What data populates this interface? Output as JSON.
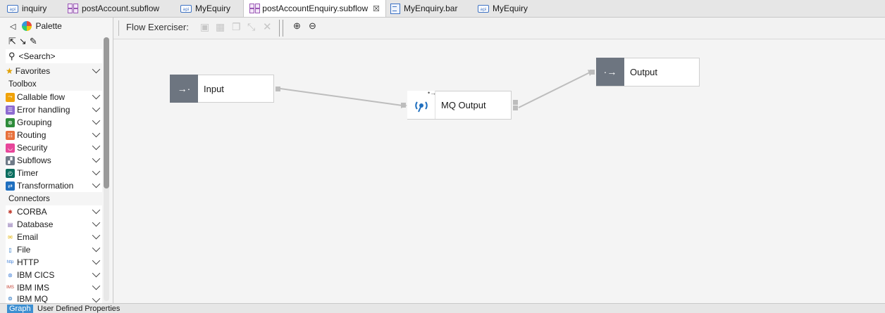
{
  "tabs": [
    {
      "label": "inquiry",
      "icon": "api-icon"
    },
    {
      "label": "postAccount.subflow",
      "icon": "subflow-icon"
    },
    {
      "label": "MyEquiry",
      "icon": "api-icon"
    },
    {
      "label": "postAccountEnquiry.subflow",
      "icon": "subflow-icon",
      "active": true
    },
    {
      "label": "MyEnquiry.bar",
      "icon": "bar-file-icon"
    },
    {
      "label": "MyEquiry",
      "icon": "api-icon"
    }
  ],
  "palette": {
    "title": "Palette",
    "search_placeholder": "<Search>",
    "favorites": "Favorites",
    "toolbox_header": "Toolbox",
    "toolbox_items": [
      {
        "label": "Callable flow",
        "color": "#f0a30a"
      },
      {
        "label": "Error handling",
        "color": "#8e6bd1"
      },
      {
        "label": "Grouping",
        "color": "#2e8b3a"
      },
      {
        "label": "Routing",
        "color": "#e8713c"
      },
      {
        "label": "Security",
        "color": "#e7469a"
      },
      {
        "label": "Subflows",
        "color": "#6f7b88"
      },
      {
        "label": "Timer",
        "color": "#0b6e5f"
      },
      {
        "label": "Transformation",
        "color": "#1f6fbf"
      }
    ],
    "connectors_header": "Connectors",
    "connector_items": [
      {
        "label": "CORBA",
        "color": "#c0392b"
      },
      {
        "label": "Database",
        "color": "#7b5ea7"
      },
      {
        "label": "Email",
        "color": "#e0b000"
      },
      {
        "label": "File",
        "color": "#1f6fbf"
      },
      {
        "label": "HTTP",
        "color": "#3a7bd5"
      },
      {
        "label": "IBM CICS",
        "color": "#3a7bd5"
      },
      {
        "label": "IBM IMS",
        "color": "#c0392b"
      },
      {
        "label": "IBM MQ",
        "color": "#1f6fbf"
      }
    ]
  },
  "toolbar": {
    "flow_exerciser": "Flow Exerciser:"
  },
  "nodes": {
    "input": "Input",
    "mq_output": "MQ Output",
    "output": "Output"
  },
  "bottom_tabs": [
    "Graph",
    "User Defined Properties"
  ]
}
